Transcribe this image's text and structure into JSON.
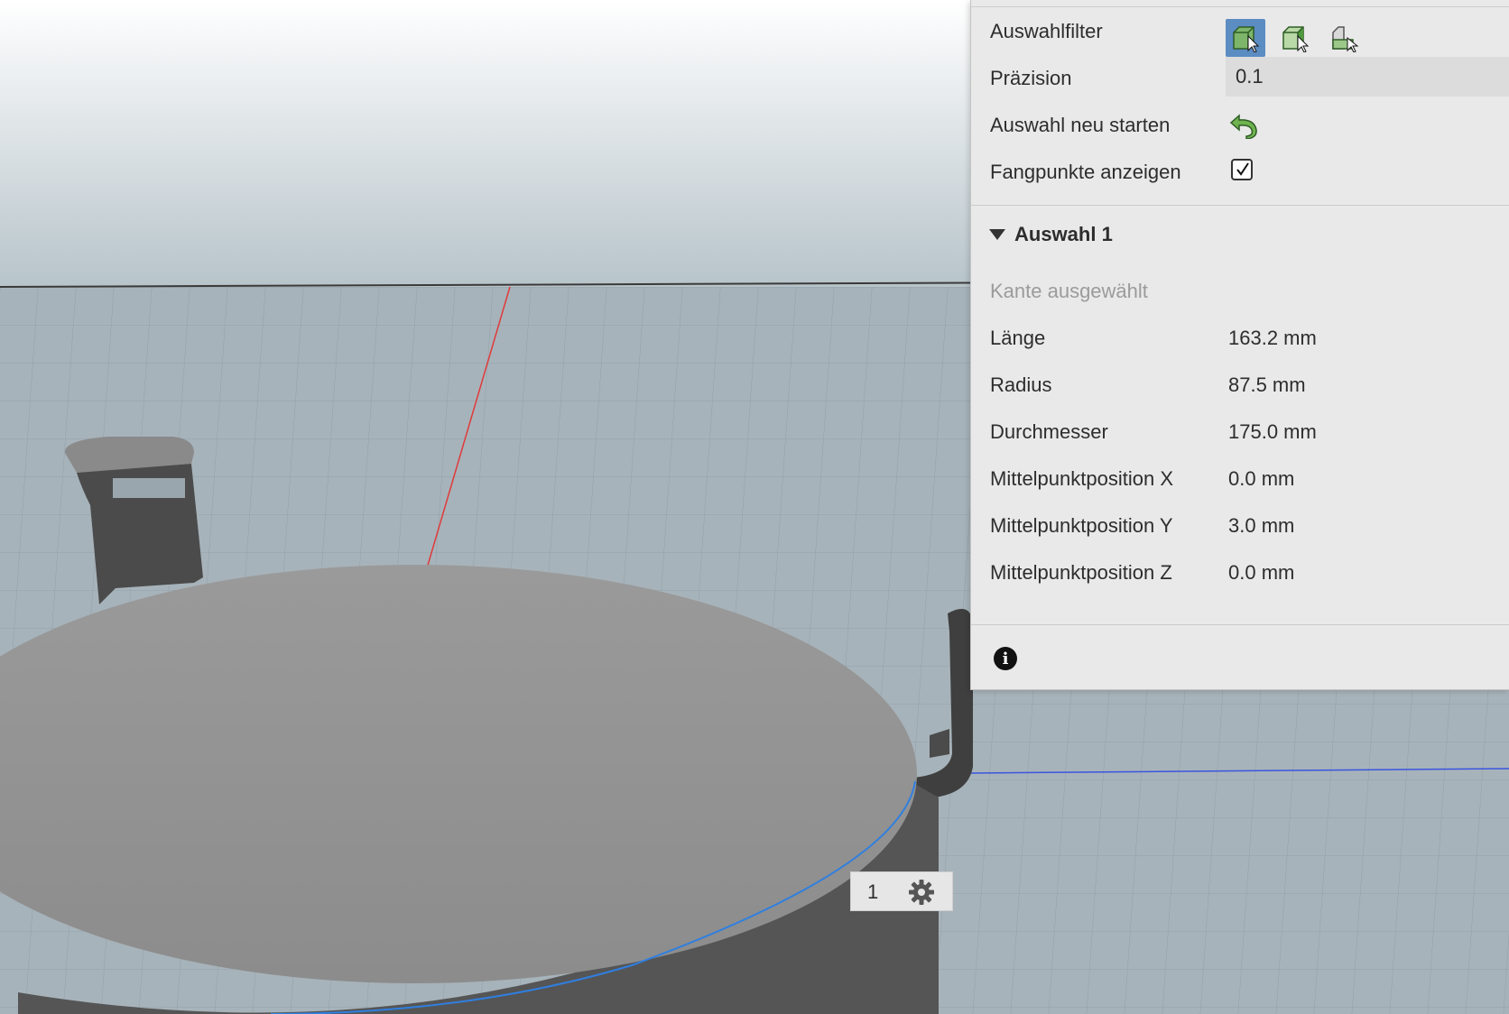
{
  "panel": {
    "filter_label": "Auswahlfilter",
    "filter_icons": [
      "body-select-icon",
      "face-select-icon",
      "edge-select-icon"
    ],
    "precision_label": "Präzision",
    "precision_value": "0.1",
    "restart_label": "Auswahl neu starten",
    "snap_label": "Fangpunkte anzeigen",
    "snap_checked": true,
    "group_title": "Auswahl 1",
    "selection_type": "Kante ausgewählt",
    "properties": [
      {
        "label": "Länge",
        "value": "163.2 mm"
      },
      {
        "label": "Radius",
        "value": "87.5 mm"
      },
      {
        "label": "Durchmesser",
        "value": "175.0 mm"
      },
      {
        "label": "Mittelpunktposition X",
        "value": "0.0 mm"
      },
      {
        "label": "Mittelpunktposition Y",
        "value": "3.0 mm"
      },
      {
        "label": "Mittelpunktposition Z",
        "value": "0.0 mm"
      }
    ]
  },
  "counter": {
    "count": "1"
  },
  "colors": {
    "accent": "#5b8cc2",
    "axis_x": "#e03a3a",
    "axis_z": "#3a55e0",
    "edge_highlight": "#2f7fe0"
  }
}
